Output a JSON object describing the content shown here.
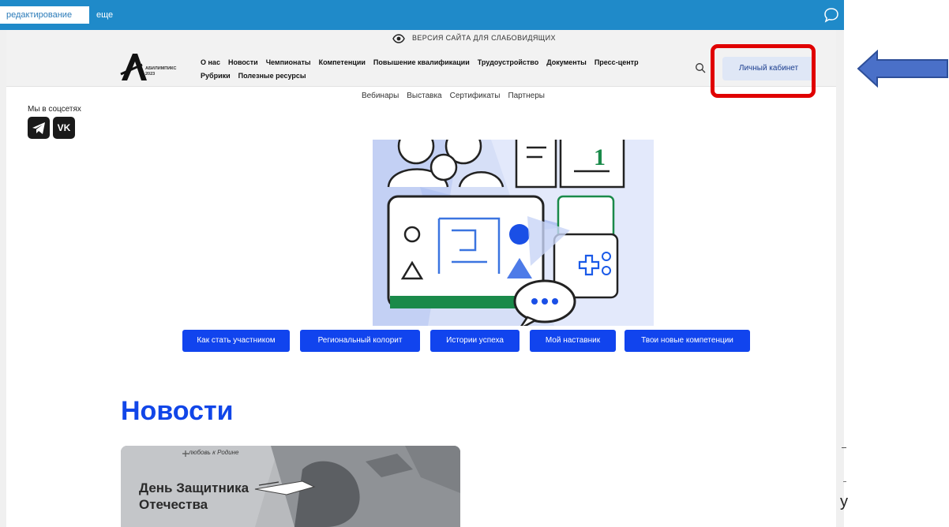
{
  "editbar": {
    "edit_tab": "редактирование",
    "more_tab": "еще",
    "chat_icon": "chat-bubble-icon"
  },
  "vision": {
    "icon": "eye-icon",
    "text": "ВЕРСИЯ САЙТА ДЛЯ СЛАБОВИДЯЩИХ"
  },
  "header": {
    "logo_text_line1": "АБИЛИМПИКС",
    "logo_text_line2": "2023",
    "nav": [
      "О нас",
      "Новости",
      "Чемпионаты",
      "Компетенции",
      "Повышение квалификации",
      "Трудоустройство",
      "Документы",
      "Пресс-центр",
      "Рубрики",
      "Полезные ресурсы"
    ],
    "search_icon": "search-icon",
    "cabinet_label": "Личный кабинет"
  },
  "subnav": [
    "Вебинары",
    "Выставка",
    "Сертификаты",
    "Партнеры"
  ],
  "social": {
    "label": "Мы в соцсетях",
    "vk_label": "VK",
    "icons": [
      "telegram-icon",
      "vk-icon"
    ]
  },
  "tags": [
    "Как стать участником",
    "Региональный колорит",
    "Истории успеха",
    "Мой наставник",
    "Твои новые компетенции"
  ],
  "news": {
    "title": "Новости",
    "card_kicker": "любовь к Родине",
    "card_title": "День Защитника Отечества"
  },
  "colors": {
    "editbar": "#1f8ac9",
    "accent_blue": "#1144ee",
    "highlight_red": "#e00000",
    "arrow_blue": "#4a70c8"
  },
  "edge_text": "у"
}
